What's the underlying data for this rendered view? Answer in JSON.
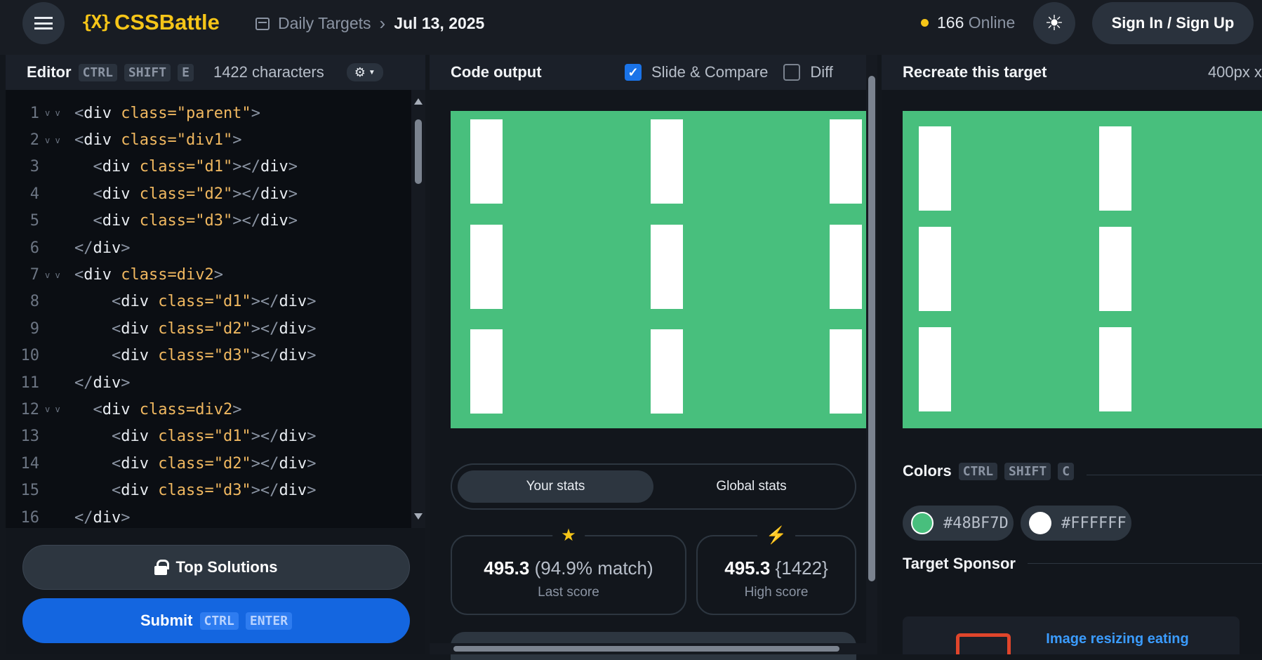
{
  "topbar": {
    "logo_mark": "{X}",
    "logo_text": "CSSBattle",
    "crumb_section": "Daily Targets",
    "crumb_date": "Jul 13, 2025",
    "online_count": "166",
    "online_label": "Online",
    "sign_label": "Sign In / Sign Up"
  },
  "editor": {
    "title": "Editor",
    "shortcut": [
      "CTRL",
      "SHIFT",
      "E"
    ],
    "char_count": "1422 characters",
    "lines": [
      {
        "n": "1",
        "fold": true,
        "indent": "",
        "open": "<",
        "tag": "div",
        "attr": " class=\"parent\"",
        "close": ">"
      },
      {
        "n": "2",
        "fold": true,
        "indent": "",
        "open": "<",
        "tag": "div",
        "attr": " class=\"div1\"",
        "close": ">"
      },
      {
        "n": "3",
        "fold": false,
        "indent": "  ",
        "open": "<",
        "tag": "div",
        "attr": " class=\"d1\"",
        "close": "></",
        "tag2": "div",
        "end": ">"
      },
      {
        "n": "4",
        "fold": false,
        "indent": "  ",
        "open": "<",
        "tag": "div",
        "attr": " class=\"d2\"",
        "close": "></",
        "tag2": "div",
        "end": ">"
      },
      {
        "n": "5",
        "fold": false,
        "indent": "  ",
        "open": "<",
        "tag": "div",
        "attr": " class=\"d3\"",
        "close": "></",
        "tag2": "div",
        "end": ">"
      },
      {
        "n": "6",
        "fold": false,
        "indent": "",
        "open": "</",
        "tag": "div",
        "attr": "",
        "close": ">"
      },
      {
        "n": "7",
        "fold": true,
        "indent": "",
        "open": "<",
        "tag": "div",
        "attr": " class=div2",
        "close": ">"
      },
      {
        "n": "8",
        "fold": false,
        "indent": "    ",
        "open": "<",
        "tag": "div",
        "attr": " class=\"d1\"",
        "close": "></",
        "tag2": "div",
        "end": ">"
      },
      {
        "n": "9",
        "fold": false,
        "indent": "    ",
        "open": "<",
        "tag": "div",
        "attr": " class=\"d2\"",
        "close": "></",
        "tag2": "div",
        "end": ">"
      },
      {
        "n": "10",
        "fold": false,
        "indent": "    ",
        "open": "<",
        "tag": "div",
        "attr": " class=\"d3\"",
        "close": "></",
        "tag2": "div",
        "end": ">"
      },
      {
        "n": "11",
        "fold": false,
        "indent": "",
        "open": "</",
        "tag": "div",
        "attr": "",
        "close": ">"
      },
      {
        "n": "12",
        "fold": true,
        "indent": "  ",
        "open": "<",
        "tag": "div",
        "attr": " class=div2",
        "close": ">"
      },
      {
        "n": "13",
        "fold": false,
        "indent": "    ",
        "open": "<",
        "tag": "div",
        "attr": " class=\"d1\"",
        "close": "></",
        "tag2": "div",
        "end": ">"
      },
      {
        "n": "14",
        "fold": false,
        "indent": "    ",
        "open": "<",
        "tag": "div",
        "attr": " class=\"d2\"",
        "close": "></",
        "tag2": "div",
        "end": ">"
      },
      {
        "n": "15",
        "fold": false,
        "indent": "    ",
        "open": "<",
        "tag": "div",
        "attr": " class=\"d3\"",
        "close": "></",
        "tag2": "div",
        "end": ">"
      },
      {
        "n": "16",
        "fold": false,
        "indent": "",
        "open": "</",
        "tag": "div",
        "attr": "",
        "close": ">"
      }
    ],
    "top_solutions_label": "Top Solutions",
    "submit_label": "Submit",
    "submit_shortcut": [
      "CTRL",
      "ENTER"
    ]
  },
  "output": {
    "title": "Code output",
    "slide_compare_label": "Slide & Compare",
    "slide_compare_checked": true,
    "diff_label": "Diff",
    "diff_checked": false,
    "tabs": [
      "Your stats",
      "Global stats"
    ],
    "active_tab": "Your stats",
    "last_score_value": "495.3",
    "last_score_sub": "(94.9% match)",
    "last_score_label": "Last score",
    "high_score_value": "495.3",
    "high_score_sub": "{1422}",
    "high_score_label": "High score"
  },
  "target": {
    "title": "Recreate this target",
    "size_label": "400px x",
    "colors_title": "Colors",
    "colors_shortcut": [
      "CTRL",
      "SHIFT",
      "C"
    ],
    "colors": [
      {
        "hex": "#48BF7D",
        "label": "#48BF7D"
      },
      {
        "hex": "#FFFFFF",
        "label": "#FFFFFF"
      }
    ],
    "sponsor_title": "Target Sponsor",
    "sponsor_text": "Image resizing eating"
  },
  "theme": {
    "accent": "#f5c518",
    "submit": "#1466e0",
    "canvas_bg": "#48BF7D",
    "shape": "#FFFFFF"
  }
}
